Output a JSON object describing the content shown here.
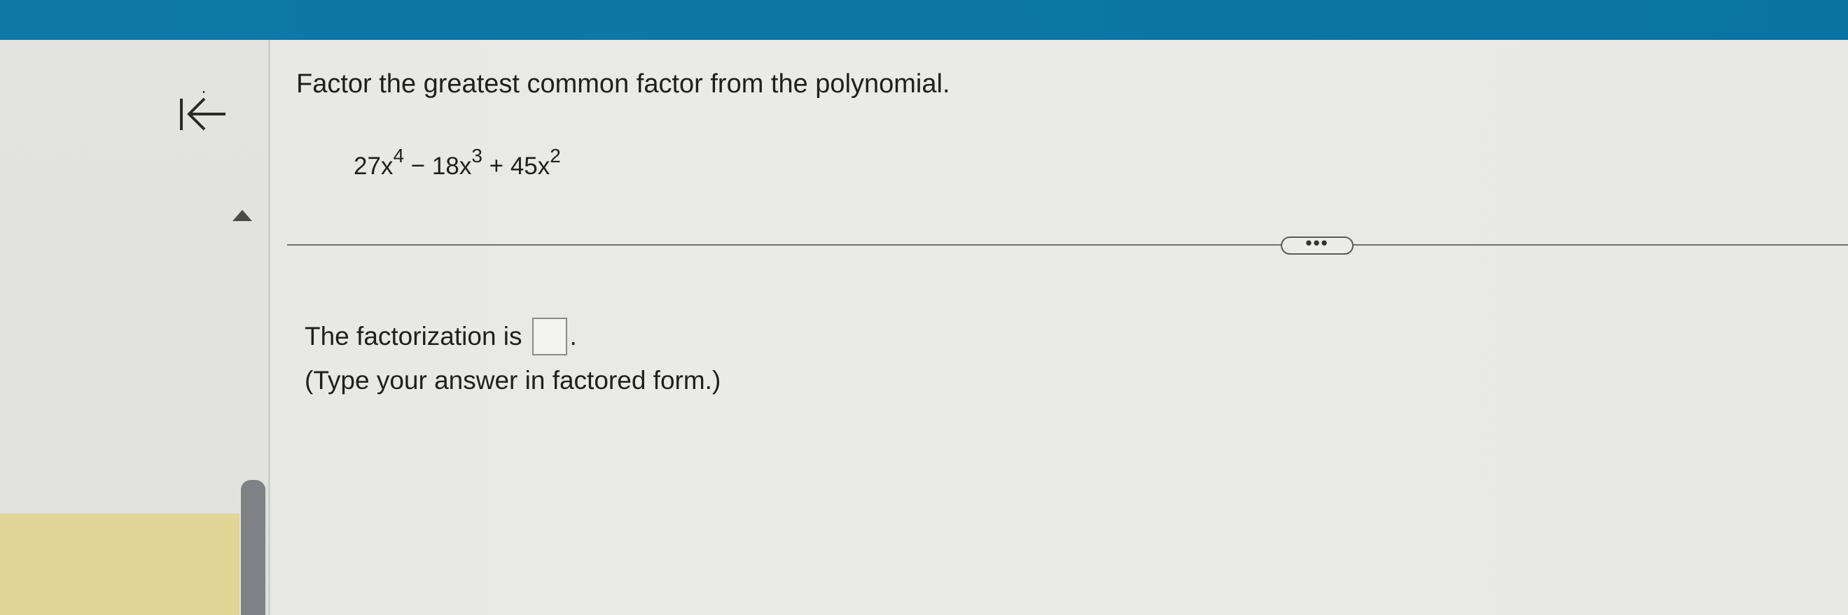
{
  "question": {
    "title": "Factor the greatest common factor from the polynomial.",
    "polynomial": {
      "terms": [
        {
          "coef": "27x",
          "exp": "4"
        },
        {
          "op": " − ",
          "coef": "18x",
          "exp": "3"
        },
        {
          "op": " + ",
          "coef": "45x",
          "exp": "2"
        }
      ]
    }
  },
  "more_button": {
    "label": "•••"
  },
  "answer": {
    "prefix": "The factorization is",
    "suffix": ".",
    "value": "",
    "instruction": "(Type your answer in factored form.)"
  },
  "icons": {
    "back": "back-to-start-icon",
    "collapse": "caret-up-icon"
  },
  "colors": {
    "top_bar": "#0f78a6",
    "highlight": "#e1d597",
    "scroll_handle": "#7e8284"
  }
}
